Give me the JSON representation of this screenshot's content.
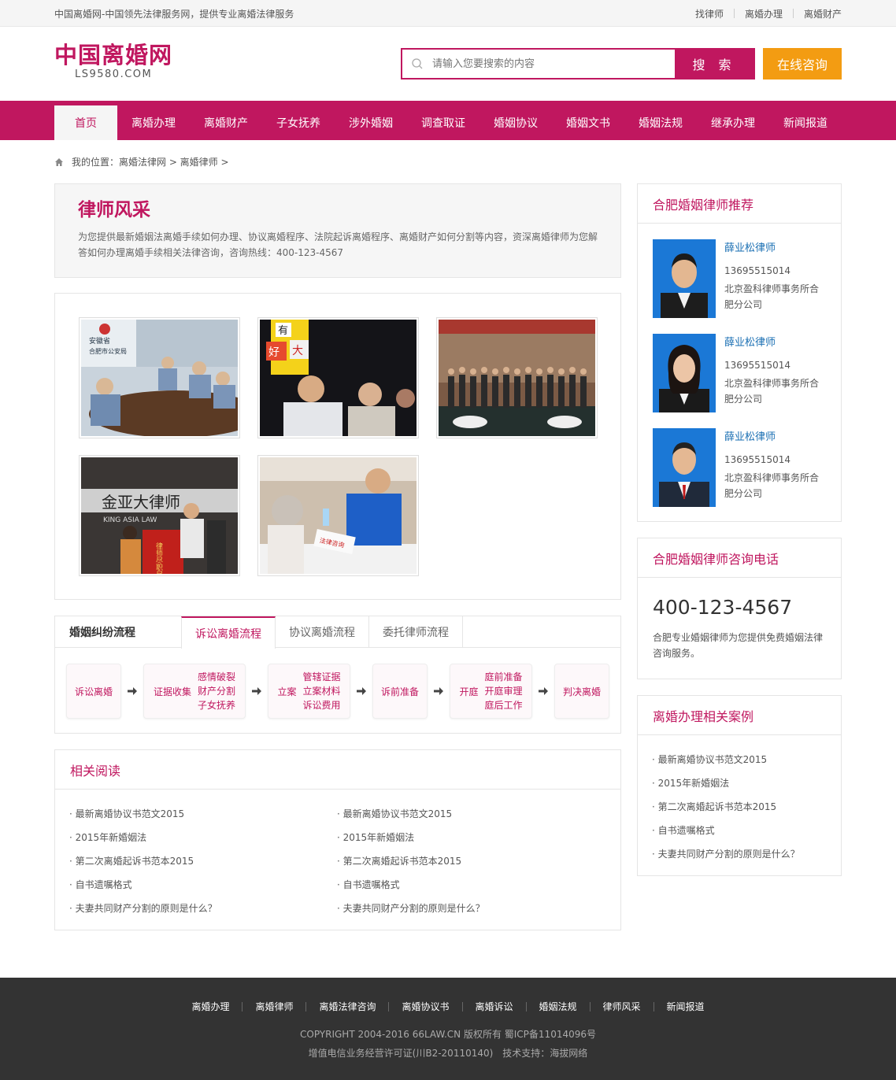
{
  "topbar": {
    "slogan": "中国离婚网-中国领先法律服务网，提供专业离婚法律服务",
    "links": [
      "找律师",
      "离婚办理",
      "离婚财产"
    ]
  },
  "logo": {
    "cn": "中国离婚网",
    "en": "LS9580.COM"
  },
  "search": {
    "placeholder": "请输入您要搜索的内容",
    "button": "搜 索"
  },
  "consult_button": "在线咨询",
  "nav": [
    "首页",
    "离婚办理",
    "离婚财产",
    "子女抚养",
    "涉外婚姻",
    "调查取证",
    "婚姻协议",
    "婚姻文书",
    "婚姻法规",
    "继承办理",
    "新闻报道"
  ],
  "breadcrumb": "我的位置：离婚法律网 > 离婚律师 >",
  "intro": {
    "title": "律师风采",
    "text": "为您提供最新婚姻法离婚手续如何办理、协议离婚程序、法院起诉离婚程序、离婚财产如何分割等内容，资深离婚律师为您解答如何办理离婚手续相关法律咨询，咨询热线：400-123-4567"
  },
  "photos": {
    "p1_sign1": "安徽省",
    "p1_sign2": "合肥市公安局",
    "p2_sign1": "有",
    "p2_sign2": "好",
    "p2_sign3": "大",
    "p4_sign1": "金亚大律师",
    "p4_sign2": "KING ASIA LAW",
    "p4_banner": "律师尽职尽",
    "p5_card": "法律咨询"
  },
  "flow": {
    "title": "婚姻纠纷流程",
    "tabs": [
      "诉讼离婚流程",
      "协议离婚流程",
      "委托律师流程"
    ],
    "s1": "诉讼离婚",
    "s2l": "证据收集",
    "s2": [
      "感情破裂",
      "财产分割",
      "子女抚养"
    ],
    "s3l": "立案",
    "s3": [
      "管辖证据",
      "立案材料",
      "诉讼费用"
    ],
    "s4": "诉前准备",
    "s5l": "开庭",
    "s5": [
      "庭前准备",
      "开庭审理",
      "庭后工作"
    ],
    "s6": "判决离婚"
  },
  "related": {
    "title": "相关阅读",
    "col1": [
      "· 最新离婚协议书范文2015",
      "· 2015年新婚姻法",
      "· 第二次离婚起诉书范本2015",
      "· 自书遗嘱格式",
      "· 夫妻共同财产分割的原则是什么？"
    ],
    "col2": [
      "· 最新离婚协议书范文2015",
      "· 2015年新婚姻法",
      "· 第二次离婚起诉书范本2015",
      "· 自书遗嘱格式",
      "· 夫妻共同财产分割的原则是什么？"
    ]
  },
  "lawyers": {
    "title": "合肥婚姻律师推荐",
    "items": [
      {
        "name": "薛业松律师",
        "phone": "13695515014",
        "firm1": "北京盈科律师事务所合",
        "firm2": "肥分公司"
      },
      {
        "name": "薛业松律师",
        "phone": "13695515014",
        "firm1": "北京盈科律师事务所合",
        "firm2": "肥分公司"
      },
      {
        "name": "薛业松律师",
        "phone": "13695515014",
        "firm1": "北京盈科律师事务所合",
        "firm2": "肥分公司"
      }
    ]
  },
  "hotline": {
    "title": "合肥婚姻律师咨询电话",
    "number": "400-123-4567",
    "desc": "合肥专业婚姻律师为您提供免费婚姻法律咨询服务。"
  },
  "cases": {
    "title": "离婚办理相关案例",
    "items": [
      "· 最新离婚协议书范文2015",
      "· 2015年新婚姻法",
      "· 第二次离婚起诉书范本2015",
      "· 自书遗嘱格式",
      "· 夫妻共同财产分割的原则是什么？"
    ]
  },
  "footer": {
    "links": [
      "离婚办理",
      "离婚律师",
      "离婚法律咨询",
      "离婚协议书",
      "离婚诉讼",
      "婚姻法规",
      "律师风采",
      "新闻报道"
    ],
    "copy1": "COPYRIGHT 2004-2016 66LAW.CN 版权所有 蜀ICP备11014096号",
    "copy2": "增值电信业务经营许可证(川B2-20110140)　技术支持：海拔网络"
  },
  "colors": {
    "brand": "#c0175f",
    "accent": "#f39c12",
    "footer": "#333333"
  }
}
